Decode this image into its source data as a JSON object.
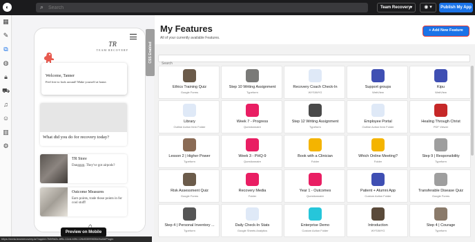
{
  "topbar": {
    "logo": "tr-logo",
    "search_placeholder": "Search",
    "team": "Team Recovery",
    "publish_label": "Publish My App"
  },
  "nav_icons": [
    "grid-icon",
    "pencil-icon",
    "layers-icon",
    "palette-icon",
    "lock-icon",
    "cart-icon",
    "bell-icon",
    "users-icon",
    "chart-icon",
    "gear-icon"
  ],
  "preview": {
    "css_tab": "CSS Enabled",
    "logo_big": "TR",
    "logo_small": "TEAM RECOVERY",
    "welcome_title": "Welcome, Tanner",
    "welcome_text": "Feel free to look around! Make yourself at home.",
    "recovery_question": "What did you do for recovery today?",
    "store_title": "TR Store",
    "store_text": "Dangggg. They've got airpods?",
    "outcome_title": "Outcome Measures",
    "outcome_text": "Earn points, trade those points in for cool stuff!",
    "preview_button": "Preview on Mobile"
  },
  "main": {
    "title": "My Features",
    "subtitle": "All of your currently available Features.",
    "add_button": "+ Add New Feature",
    "search_placeholder": "Search"
  },
  "features": [
    {
      "name": "Ethics Training Quiz",
      "type": "Google Forms",
      "color": "#6b5b4a"
    },
    {
      "name": "Step 10 Writing Assignment",
      "type": "Typeform",
      "color": "#7a7a78"
    },
    {
      "name": "Recovery Coach Check-In",
      "type": "WYSIWYG",
      "color": "#dfe9f7"
    },
    {
      "name": "Support groups",
      "type": "WebView",
      "color": "#3f4fb3"
    },
    {
      "name": "Kipu",
      "type": "WebView",
      "color": "#3f4fb3"
    },
    {
      "name": "Library",
      "type": "Outline Action Item Folder",
      "color": "#dfe9f7"
    },
    {
      "name": "Week 7 - Progress",
      "type": "Questionnaire",
      "color": "#e91e63"
    },
    {
      "name": "Step 12 Writing Assignment",
      "type": "Typeform",
      "color": "#4a4a4a"
    },
    {
      "name": "Employee Portal",
      "type": "Outline Action Item Folder",
      "color": "#dfe9f7"
    },
    {
      "name": "Healing Through Christ",
      "type": "PDF Viewer",
      "color": "#c62828"
    },
    {
      "name": "Lesson 2 | Higher Power",
      "type": "Typeform",
      "color": "#8a6b55"
    },
    {
      "name": "Week 3 - PHQ-9",
      "type": "Questionnaire",
      "color": "#e91e63"
    },
    {
      "name": "Book with a Clinician",
      "type": "Folder",
      "color": "#f4b400"
    },
    {
      "name": "Which Online Meeting?",
      "type": "Folder",
      "color": "#f4b400"
    },
    {
      "name": "Step 9 | Responsibility",
      "type": "Typeform",
      "color": "#9e9e9e"
    },
    {
      "name": "Risk Assessment Quiz",
      "type": "Google Forms",
      "color": "#6b5b4a"
    },
    {
      "name": "Recovery Media",
      "type": "Folder",
      "color": "#e91e63"
    },
    {
      "name": "Year 1 - Outcomes",
      "type": "Questionnaire",
      "color": "#e91e63"
    },
    {
      "name": "Patient + Alumni App",
      "type": "Custom Action Folder",
      "color": "#3f4fb3"
    },
    {
      "name": "Transferable Disease Quiz",
      "type": "Google Forms",
      "color": "#9e9e9e"
    },
    {
      "name": "Step 4 | Personal Inventory ...",
      "type": "Typeform",
      "color": "#555555"
    },
    {
      "name": "Daily Check-In Stats",
      "type": "Google Sheets Analytics",
      "color": "#dfe9f7"
    },
    {
      "name": "Enterprise Demo",
      "type": "Custom Action Folder",
      "color": "#26c6da"
    },
    {
      "name": "Introduction",
      "type": "WYSIWYG",
      "color": "#5a4a3a"
    },
    {
      "name": "Step 4 | Courage",
      "type": "Typeform",
      "color": "#8a7a6a"
    }
  ],
  "statusbar": "https://meta.teamrecovery.io/?appId=7b5f9d2c-8f9c-11ed-b0f4-126d53099830#/build/Plugin"
}
